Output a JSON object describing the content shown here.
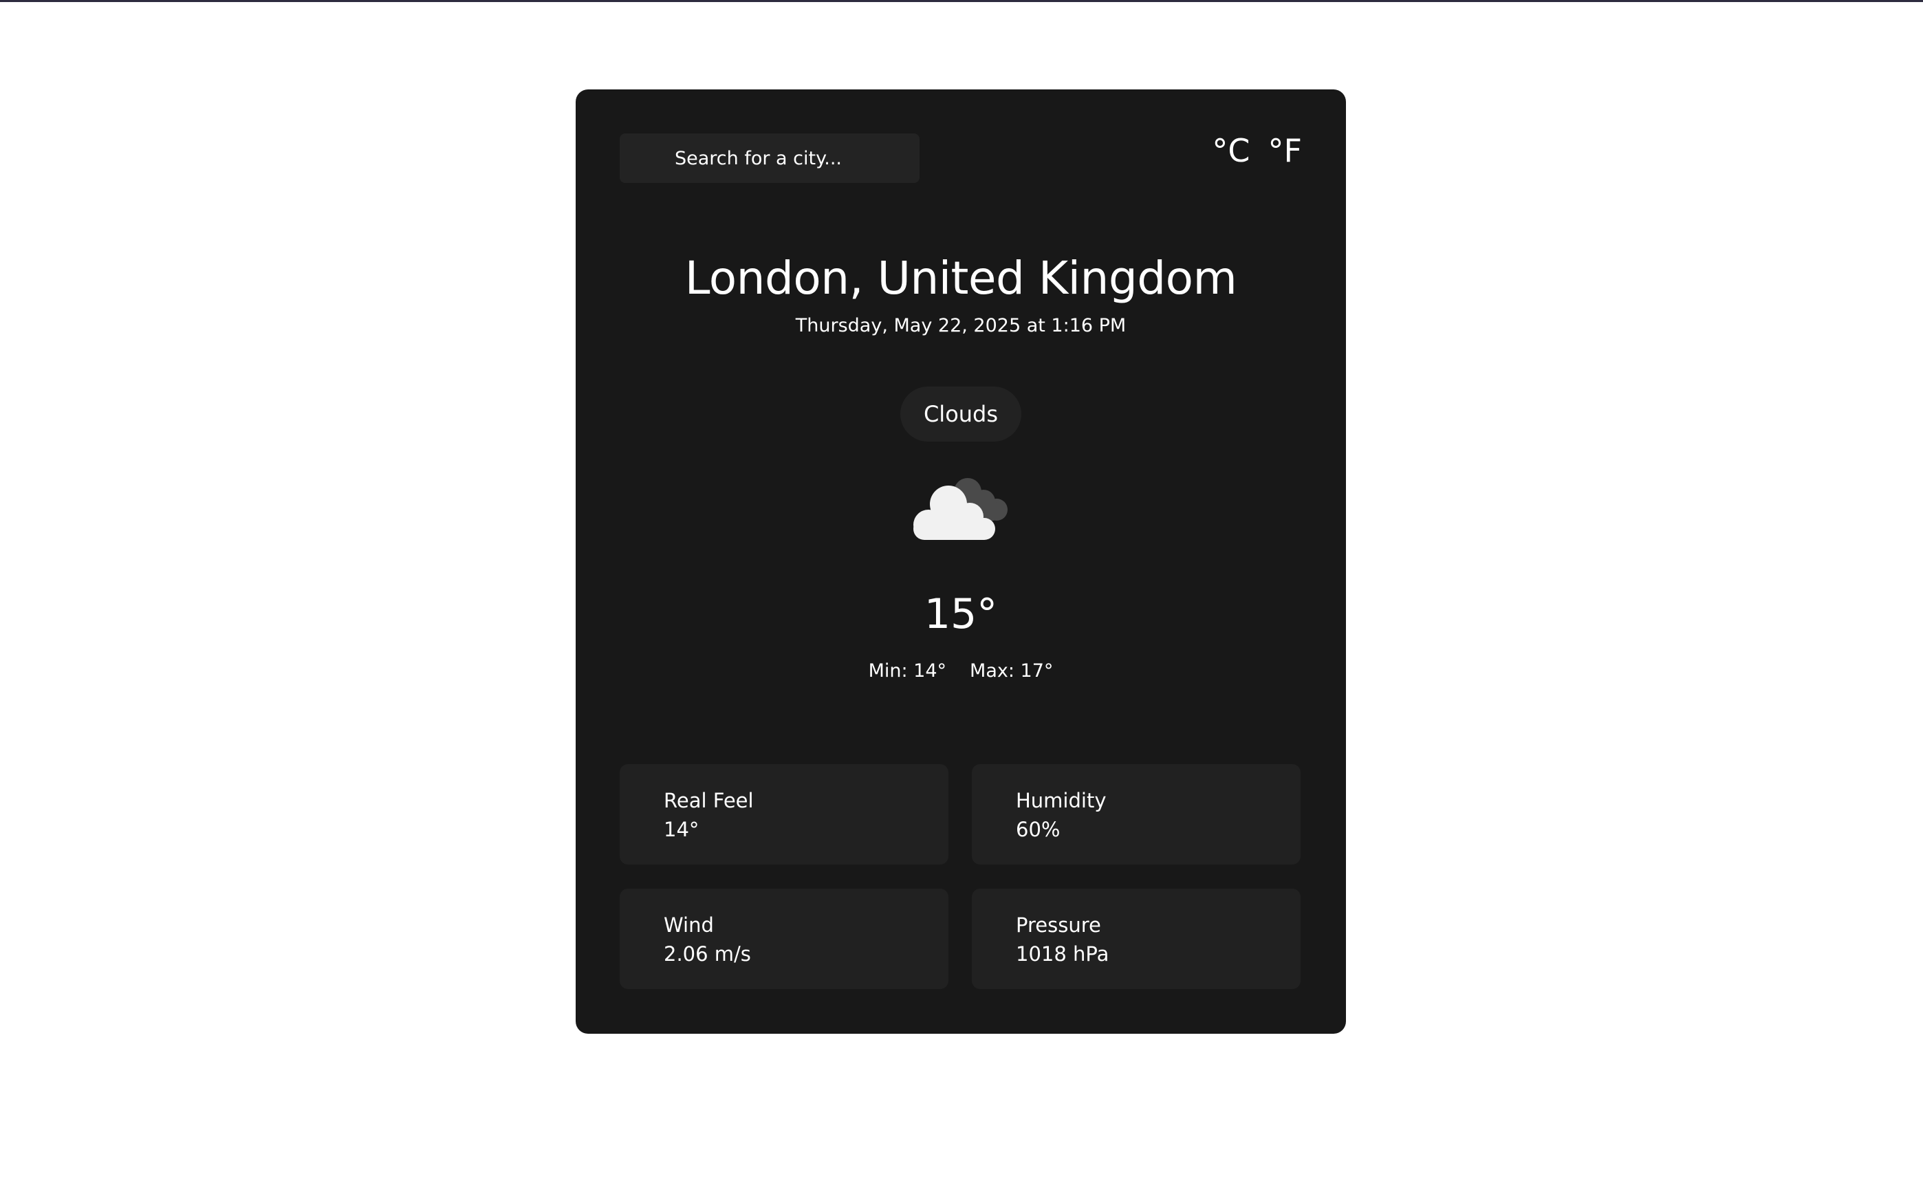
{
  "search": {
    "placeholder": "Search for a city..."
  },
  "units": {
    "celsius": "°C",
    "fahrenheit": "°F"
  },
  "location": {
    "city": "London, United Kingdom",
    "datetime": "Thursday, May 22, 2025 at 1:16 PM"
  },
  "weather": {
    "condition": "Clouds",
    "icon": "clouds-icon",
    "temperature": "15°",
    "min": "Min: 14°",
    "max": "Max: 17°"
  },
  "details": {
    "real_feel": {
      "label": "Real Feel",
      "value": "14°"
    },
    "humidity": {
      "label": "Humidity",
      "value": "60%"
    },
    "wind": {
      "label": "Wind",
      "value": "2.06 m/s"
    },
    "pressure": {
      "label": "Pressure",
      "value": "1018 hPa"
    }
  },
  "colors": {
    "card_background": "#181818",
    "tile_background": "#212121",
    "top_border": "#2e2c3f"
  }
}
